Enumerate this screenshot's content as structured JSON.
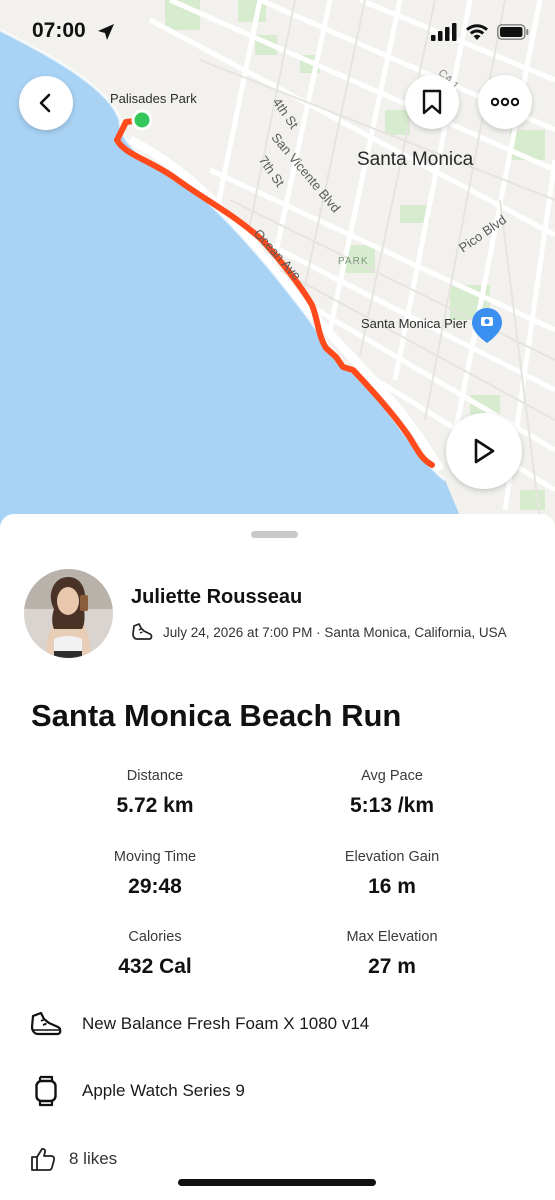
{
  "status_bar": {
    "time": "07:00",
    "icons": [
      "location-arrow-icon",
      "cellular-signal-icon",
      "wifi-icon",
      "battery-icon"
    ]
  },
  "map": {
    "city_label": "Santa Monica",
    "place_labels": {
      "palisades_park": "Palisades Park",
      "santa_monica_pier": "Santa Monica Pier",
      "park": "PARK"
    },
    "street_labels": {
      "fourth_st": "4th St",
      "seventh_st": "7th St",
      "san_vicente_blvd": "San Vicente Blvd",
      "ocean_ave": "Ocean Ave",
      "pico_blvd": "Pico Blvd",
      "ca_1": "CA 1"
    },
    "route_color": "#ff4a1c",
    "start_marker_color": "#34c759",
    "water_color": "#a9d3f5",
    "land_color": "#f2f1ee"
  },
  "controls": {
    "back": "chevron-left-icon",
    "bookmark": "bookmark-icon",
    "more": "more-horizontal-icon",
    "play": "play-icon"
  },
  "athlete": {
    "name": "Juliette Rousseau",
    "activity_icon": "running-shoe-icon",
    "meta": "July 24, 2026 at 7:00 PM · Santa Monica, California, USA"
  },
  "activity": {
    "title": "Santa Monica Beach Run"
  },
  "stats": [
    {
      "label": "Distance",
      "value": "5.72 km"
    },
    {
      "label": "Avg Pace",
      "value": "5:13 /km"
    },
    {
      "label": "Moving Time",
      "value": "29:48"
    },
    {
      "label": "Elevation Gain",
      "value": "16 m"
    },
    {
      "label": "Calories",
      "value": "432 Cal"
    },
    {
      "label": "Max Elevation",
      "value": "27 m"
    }
  ],
  "gear": {
    "shoes": {
      "icon": "shoe-icon",
      "label": "New Balance Fresh Foam X 1080 v14"
    },
    "device": {
      "icon": "smartwatch-icon",
      "label": "Apple Watch Series 9"
    }
  },
  "kudos": {
    "icon": "thumbs-up-icon",
    "label": "8 likes"
  }
}
